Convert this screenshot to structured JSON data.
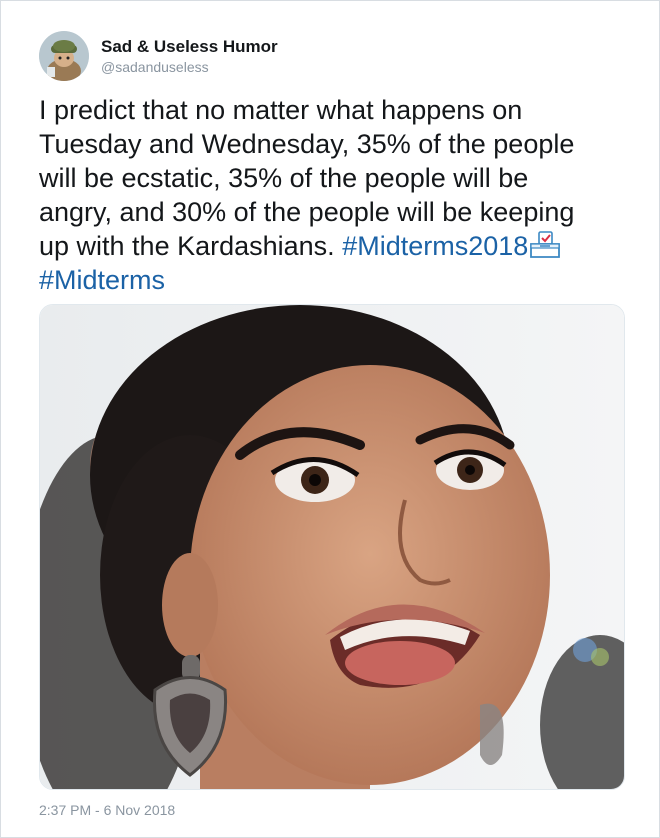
{
  "author": {
    "display_name": "Sad & Useless Humor",
    "handle": "@sadanduseless"
  },
  "tweet": {
    "line1": "I predict that no matter what happens on",
    "line2": "Tuesday and Wednesday, 35% of the people",
    "line3": "will be ecstatic, 35% of the people will be",
    "line4": "angry, and 30% of the people will be keeping",
    "line5_text": "up with the Kardashians. ",
    "hashtag1": "#Midterms2018",
    "hashtag2": "#Midterms"
  },
  "timestamp": "2:37 PM - 6 Nov 2018",
  "colors": {
    "text": "#14171a",
    "muted": "#8a95a0",
    "link": "#1b62a6",
    "border": "#d8dde2"
  },
  "icons": {
    "avatar": "avatar-image",
    "ballot": "ballot-box-emoji"
  }
}
